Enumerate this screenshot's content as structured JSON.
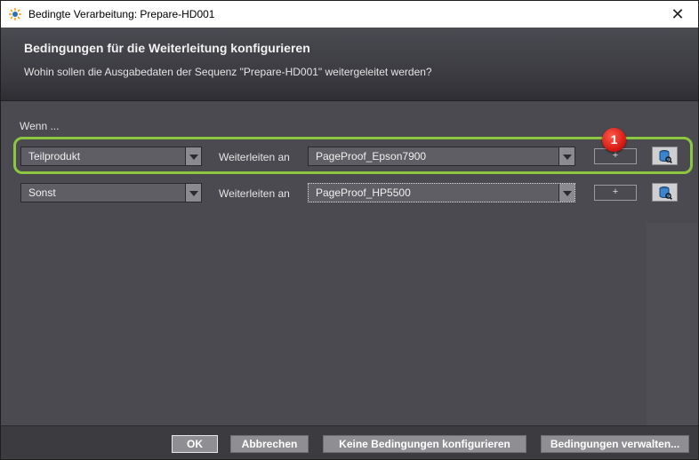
{
  "window": {
    "title": "Bedingte Verarbeitung: Prepare-HD001",
    "close_glyph": "✕"
  },
  "header": {
    "title": "Bedingungen für die Weiterleitung konfigurieren",
    "subtitle": "Wohin sollen die Ausgabedaten der Sequenz \"Prepare-HD001\" weitergeleitet werden?"
  },
  "main": {
    "wenn_label": "Wenn ...",
    "badge": "1",
    "rows": [
      {
        "condition": "Teilprodukt",
        "forward_label": "Weiterleiten an",
        "target": "PageProof_Epson7900",
        "add_label": "+"
      },
      {
        "condition": "Sonst",
        "forward_label": "Weiterleiten an",
        "target": "PageProof_HP5500",
        "add_label": "+"
      }
    ]
  },
  "footer": {
    "ok": "OK",
    "cancel": "Abbrechen",
    "no_conditions": "Keine Bedingungen konfigurieren",
    "manage": "Bedingungen verwalten..."
  },
  "colors": {
    "highlight": "#8dc63f",
    "badge": "#d1140f"
  }
}
